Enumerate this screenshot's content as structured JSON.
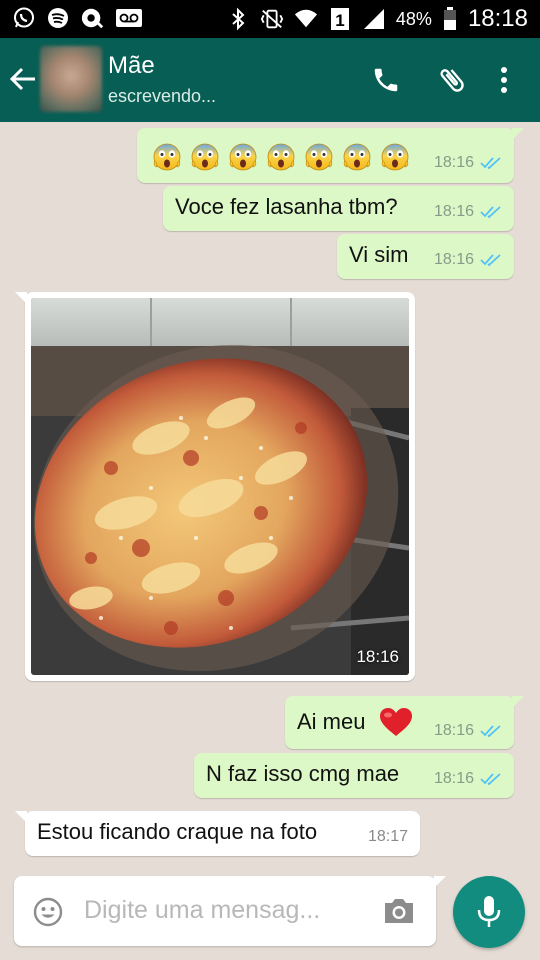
{
  "status_bar": {
    "battery": "48%",
    "time": "18:18",
    "sim_slot": "1",
    "icons": [
      "whatsapp-icon",
      "spotify-icon",
      "podcast-icon",
      "voicemail-icon",
      "bluetooth-icon",
      "vibrate-icon",
      "wifi-icon",
      "sim-icon",
      "signal-icon",
      "battery-icon"
    ]
  },
  "header": {
    "contact_name": "Mãe",
    "contact_status": "escrevendo...",
    "icons": [
      "back-arrow-icon",
      "phone-icon",
      "paperclip-icon",
      "more-vert-icon"
    ],
    "colors": {
      "toolbar": "#075e54",
      "accent": "#128c7e"
    }
  },
  "messages": [
    {
      "direction": "out",
      "text": "😱😱😱😱😱😱😱",
      "emoji_count": 7,
      "time": "18:16",
      "read": true
    },
    {
      "direction": "out",
      "text": "Voce fez lasanha tbm?",
      "time": "18:16",
      "read": true
    },
    {
      "direction": "out",
      "text": "Vi sim",
      "time": "18:16",
      "read": true
    },
    {
      "direction": "in",
      "type": "image",
      "image": "lasagna-photo",
      "time": "18:16"
    },
    {
      "direction": "out",
      "text": "Ai meu",
      "emoji": "heart-icon",
      "time": "18:16",
      "read": true
    },
    {
      "direction": "out",
      "text": "N faz isso cmg mae",
      "time": "18:16",
      "read": true
    },
    {
      "direction": "in",
      "text": "Estou ficando craque na foto",
      "time": "18:17"
    }
  ],
  "composer": {
    "placeholder": "Digite uma mensag...",
    "icons": [
      "emoji-icon",
      "camera-icon",
      "mic-icon"
    ]
  },
  "colors": {
    "chat_bg": "#e5ddd5",
    "outgoing_bubble": "#dcf8c6",
    "incoming_bubble": "#ffffff",
    "read_ticks": "#4fc3f7"
  }
}
